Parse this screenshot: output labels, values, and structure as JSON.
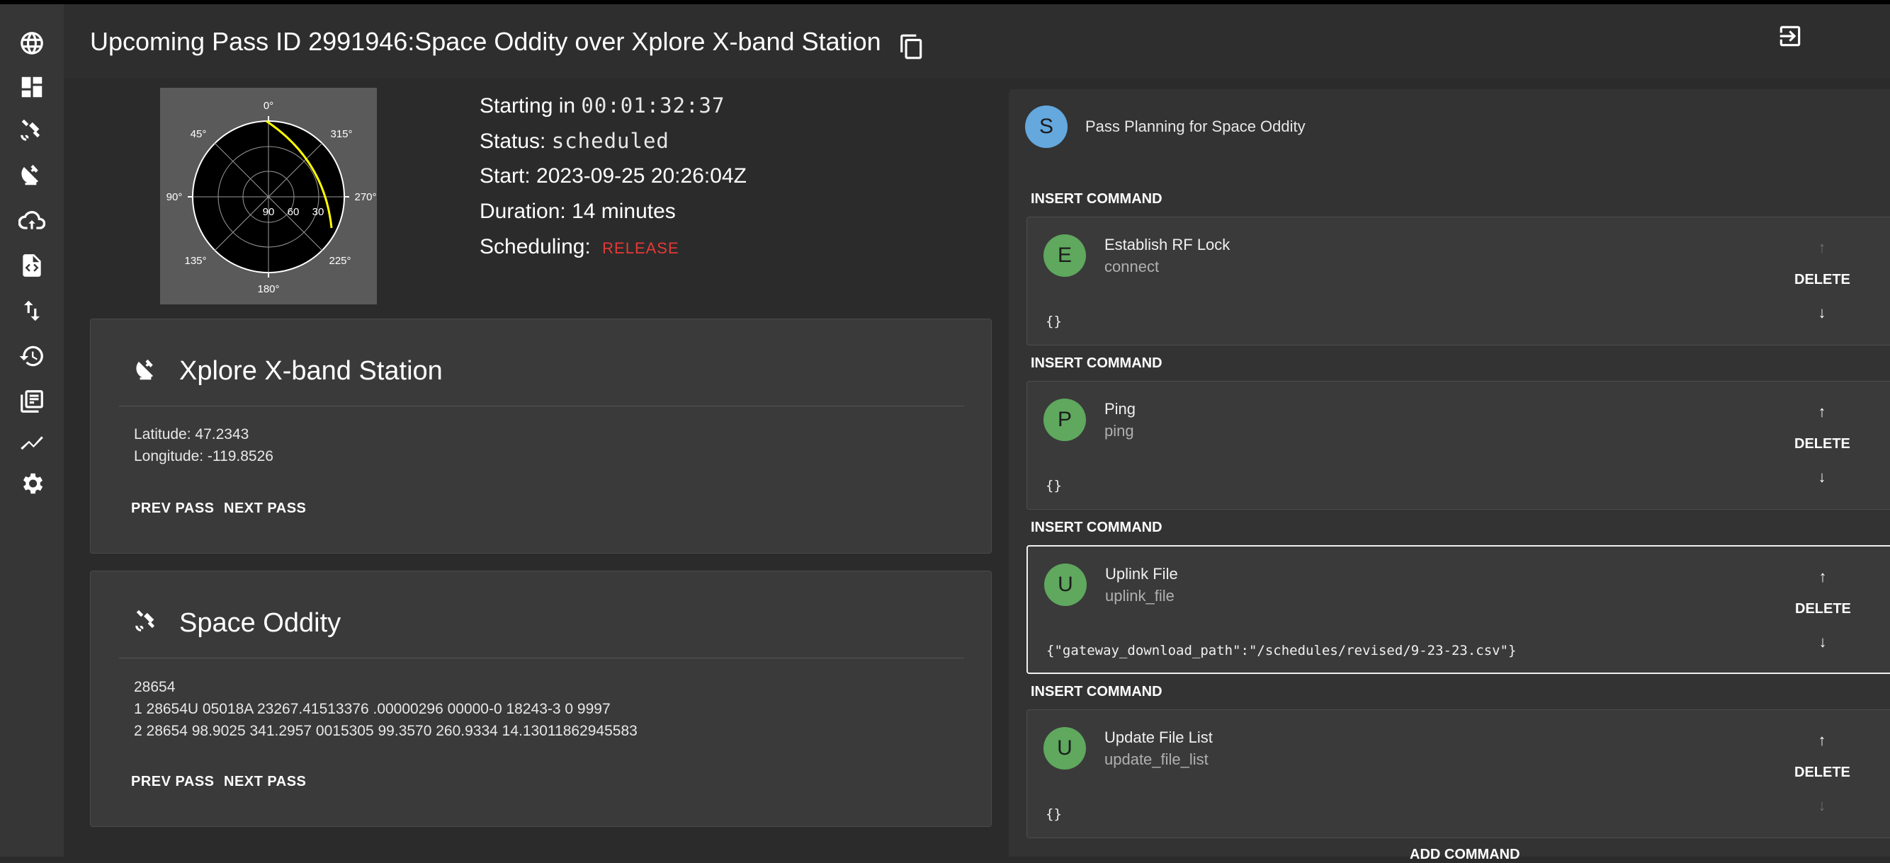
{
  "header": {
    "title": "Upcoming Pass ID 2991946:Space Oddity over Xplore X-band Station"
  },
  "sidebar": {
    "items": [
      {
        "icon": "globe-icon"
      },
      {
        "icon": "dashboard-icon"
      },
      {
        "icon": "satellite-icon"
      },
      {
        "icon": "satellite-dish-icon"
      },
      {
        "icon": "cloud-sync-icon"
      },
      {
        "icon": "code-file-icon"
      },
      {
        "icon": "swap-vertical-icon"
      },
      {
        "icon": "history-icon"
      },
      {
        "icon": "documents-icon"
      },
      {
        "icon": "chart-line-icon"
      },
      {
        "icon": "settings-icon"
      }
    ]
  },
  "polar": {
    "az_labels": [
      "0°",
      "315°",
      "270°",
      "225°",
      "180°",
      "135°",
      "90°",
      "45°"
    ],
    "el_labels": [
      "90",
      "60",
      "30"
    ],
    "track_color": "#ffff00"
  },
  "pass": {
    "starting_label": "Starting in",
    "starting_value": "00:01:32:37",
    "status_label": "Status:",
    "status_value": "scheduled",
    "start": "Start: 2023-09-25 20:26:04Z",
    "duration": "Duration: 14 minutes",
    "scheduling_label": "Scheduling:",
    "scheduling_action": "RELEASE"
  },
  "station": {
    "name": "Xplore X-band Station",
    "icon": "satellite-dish-icon",
    "latitude": "Latitude: 47.2343",
    "longitude": "Longitude: -119.8526",
    "prev": "PREV PASS",
    "next": "NEXT PASS"
  },
  "satellite": {
    "name": "Space Oddity",
    "icon": "satellite-icon",
    "norad": "28654",
    "tle1": "1 28654U 05018A 23267.41513376 .00000296 00000-0 18243-3 0 9997",
    "tle2": "2 28654 98.9025 341.2957 0015305 99.3570 260.9334 14.13011862945583",
    "prev": "PREV PASS",
    "next": "NEXT PASS"
  },
  "planning": {
    "avatar": "S",
    "avatar_color": "#64a8de",
    "title": "Pass Planning for Space Oddity",
    "insert_label": "INSERT COMMAND",
    "delete_label": "DELETE",
    "up_arrow": "↑",
    "down_arrow": "↓",
    "add_label": "ADD COMMAND",
    "commands": [
      {
        "avatar": "E",
        "name": "Establish RF Lock",
        "method": "connect",
        "args": "{}"
      },
      {
        "avatar": "P",
        "name": "Ping",
        "method": "ping",
        "args": "{}"
      },
      {
        "avatar": "U",
        "name": "Uplink File",
        "method": "uplink_file",
        "args": "{\"gateway_download_path\":\"/schedules/revised/9-23-23.csv\"}"
      },
      {
        "avatar": "U",
        "name": "Update File List",
        "method": "update_file_list",
        "args": "{}"
      }
    ]
  }
}
